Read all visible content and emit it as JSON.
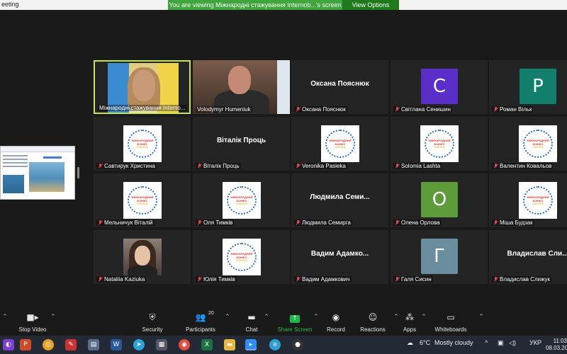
{
  "window": {
    "app_title": "eeting",
    "viewing_banner": "You are viewing Міжнародні стажування Internob...'s screen",
    "view_options": "View Options"
  },
  "gallery": [
    {
      "kind": "video-woman",
      "label": "Міжнародні стажування  Interno...",
      "muted": false,
      "active": true
    },
    {
      "kind": "video-man",
      "label": "Volodymyr Humeniuk",
      "muted": false
    },
    {
      "kind": "name",
      "display": "Оксана Пояснюк",
      "label": "Оксана Пояснюк",
      "muted": true
    },
    {
      "kind": "avatar",
      "letter": "C",
      "color": "#5a2fc9",
      "label": "Світлана Сенишин",
      "muted": true
    },
    {
      "kind": "avatar",
      "letter": "P",
      "color": "#127f6d",
      "label": "Роман Вільк",
      "muted": true
    },
    {
      "kind": "logo",
      "label": "Савтирук Христина",
      "muted": true
    },
    {
      "kind": "name",
      "display": "Віталік Проць",
      "label": "Віталік Проць",
      "muted": true
    },
    {
      "kind": "logo",
      "label": "Veronika Pasieka",
      "muted": true
    },
    {
      "kind": "logo",
      "label": "Solomia Lashta",
      "muted": true
    },
    {
      "kind": "logo",
      "label": "Валентин Ковальов",
      "muted": true
    },
    {
      "kind": "logo",
      "label": "Мельничук Віталій",
      "muted": true
    },
    {
      "kind": "logo",
      "label": "Оля Тимків",
      "muted": true
    },
    {
      "kind": "name",
      "display": "Людмила  Семи...",
      "label": "Людмила Семирга",
      "muted": true
    },
    {
      "kind": "avatar",
      "letter": "O",
      "color": "#5e9b3a",
      "label": "Олена Орлова",
      "muted": true
    },
    {
      "kind": "logo",
      "label": "Міша Будзак",
      "muted": true
    },
    {
      "kind": "photo",
      "label": "Nataliia Kaziuka",
      "muted": true
    },
    {
      "kind": "logo",
      "label": "Юлія Тимків",
      "muted": true
    },
    {
      "kind": "name",
      "display": "Вадим  Адамко...",
      "label": "Вадим Адамкович",
      "muted": true
    },
    {
      "kind": "avatar",
      "letter": "Г",
      "color": "#6b8e9e",
      "label": "Галя Сисин",
      "muted": true
    },
    {
      "kind": "name",
      "display": "Владислав  Сли...",
      "label": "Владислав Слижук",
      "muted": true
    }
  ],
  "logo_text": {
    "line1": "МІЖНАРОДНИЙ",
    "line2": "БІЗНЕС",
    "line3": "Internship"
  },
  "toolbar": {
    "stop_video": "Stop Video",
    "security": "Security",
    "participants": "Participants",
    "participants_count": "20",
    "chat": "Chat",
    "share_screen": "Share Screen",
    "record": "Record",
    "reactions": "Reactions",
    "apps": "Apps",
    "whiteboards": "Whiteboards"
  },
  "taskbar": {
    "weather_temp": "6°C",
    "weather_desc": "Mostly cloudy",
    "language": "УКР",
    "time": "11:03",
    "date": "08.03.20"
  }
}
